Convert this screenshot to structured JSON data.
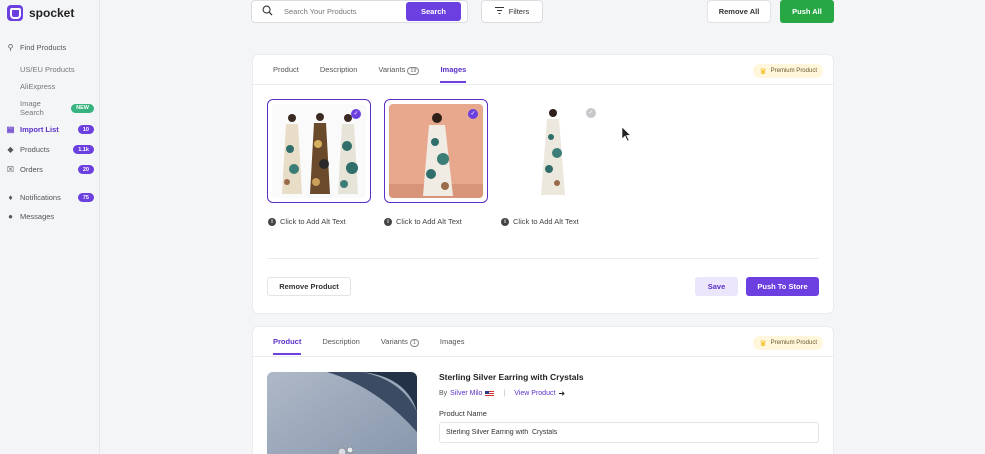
{
  "app": {
    "name": "spocket",
    "brand_color": "#6c3fe0",
    "success_color": "#28a745"
  },
  "sidebar": {
    "find_products": "Find Products",
    "sub_items": [
      {
        "label": "US/EU Products"
      },
      {
        "label": "AliExpress"
      },
      {
        "label": "Image Search",
        "badge": "NEW"
      }
    ],
    "items": [
      {
        "label": "Import List",
        "badge": "10",
        "active": true
      },
      {
        "label": "Products",
        "badge": "1.1k"
      },
      {
        "label": "Orders",
        "badge": "20"
      },
      {
        "label": "Notifications",
        "badge": "75"
      },
      {
        "label": "Messages"
      }
    ]
  },
  "topbar": {
    "search_placeholder": "Search Your Products",
    "search_button": "Search",
    "filters": "Filters",
    "remove_all": "Remove All",
    "push_all": "Push All"
  },
  "card1": {
    "tabs": [
      {
        "label": "Product"
      },
      {
        "label": "Description"
      },
      {
        "label": "Variants",
        "count": "19"
      },
      {
        "label": "Images",
        "active": true
      }
    ],
    "premium": "Premium Product",
    "images": [
      {
        "alt_text": "Click to Add Alt Text",
        "selected": true
      },
      {
        "alt_text": "Click to Add Alt Text",
        "selected": true
      },
      {
        "alt_text": "Click to Add Alt Text",
        "selected": false
      }
    ],
    "remove_product": "Remove Product",
    "save": "Save",
    "push_to_store": "Push To Store"
  },
  "card2": {
    "tabs": [
      {
        "label": "Product",
        "active": true
      },
      {
        "label": "Description"
      },
      {
        "label": "Variants",
        "count": "1"
      },
      {
        "label": "Images"
      }
    ],
    "premium": "Premium Product",
    "title": "Sterling Silver Earring with Crystals",
    "by_prefix": "By",
    "vendor": "Silver Milo",
    "view_product": "View Product",
    "product_name_label": "Product Name",
    "product_name_value": "Sterling Silver Earring with  Crystals"
  }
}
